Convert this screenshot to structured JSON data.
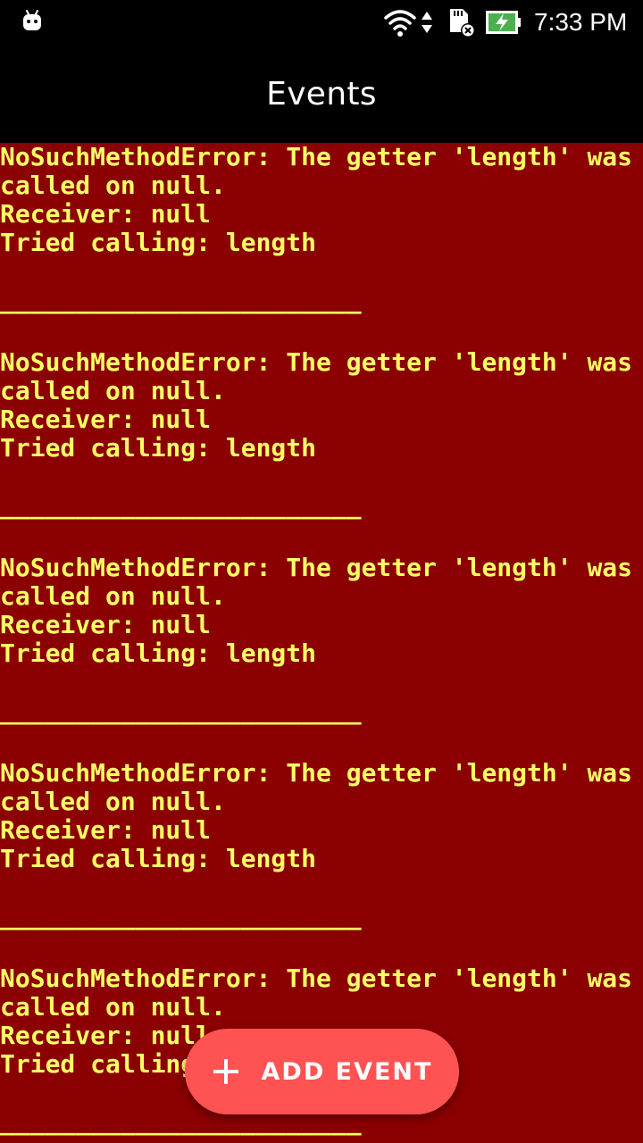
{
  "status_bar": {
    "time": "7:33 PM",
    "icons": [
      "android-icon",
      "wifi-icon",
      "data-arrows-icon",
      "sd-card-error-icon",
      "battery-charging-icon"
    ]
  },
  "app_bar": {
    "title": "Events"
  },
  "events": [
    {
      "lines": [
        "NoSuchMethodError: The getter 'length' was",
        "called on null.",
        "Receiver: null",
        "Tried calling: length"
      ],
      "separator": "________________________"
    },
    {
      "lines": [
        "NoSuchMethodError: The getter 'length' was",
        "called on null.",
        "Receiver: null",
        "Tried calling: length"
      ],
      "separator": "________________________"
    },
    {
      "lines": [
        "NoSuchMethodError: The getter 'length' was",
        "called on null.",
        "Receiver: null",
        "Tried calling: length"
      ],
      "separator": "________________________"
    },
    {
      "lines": [
        "NoSuchMethodError: The getter 'length' was",
        "called on null.",
        "Receiver: null",
        "Tried calling: length"
      ],
      "separator": "________________________"
    },
    {
      "lines": [
        "NoSuchMethodError: The getter 'length' was",
        "called on null.",
        "Receiver: null",
        "Tried calling: length"
      ],
      "separator": "________________________"
    }
  ],
  "fab": {
    "label": "ADD EVENT",
    "icon": "plus-icon"
  },
  "colors": {
    "background": "#8b0000",
    "error_text": "#ffff66",
    "fab": "#ff5252",
    "bars": "#000000"
  }
}
